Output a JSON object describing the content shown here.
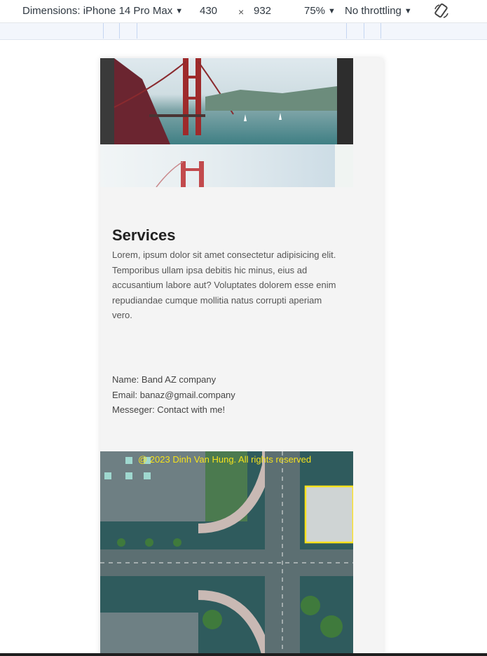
{
  "devtools": {
    "dimensions_label": "Dimensions: iPhone 14 Pro Max",
    "width": "430",
    "times": "×",
    "height": "932",
    "zoom": "75%",
    "throttling": "No throttling",
    "rotate_icon": "rotate-icon"
  },
  "page": {
    "services_title": "Services",
    "services_text": "Lorem, ipsum dolor sit amet consectetur adipisicing elit. Temporibus ullam ipsa debitis hic minus, eius ad accusantium labore aut? Voluptates dolorem esse enim repudiandae cumque mollitia natus corrupti aperiam vero.",
    "contact": {
      "name": "Name: Band AZ company",
      "email": "Email: banaz@gmail.company",
      "messenger": "Messeger: Contact with me!"
    },
    "footer_copyright": "@ 2023 Dinh Van Hung. All rights reserved"
  },
  "colors": {
    "footer_text": "#f5e21c",
    "page_bg": "#f4f4f4"
  }
}
